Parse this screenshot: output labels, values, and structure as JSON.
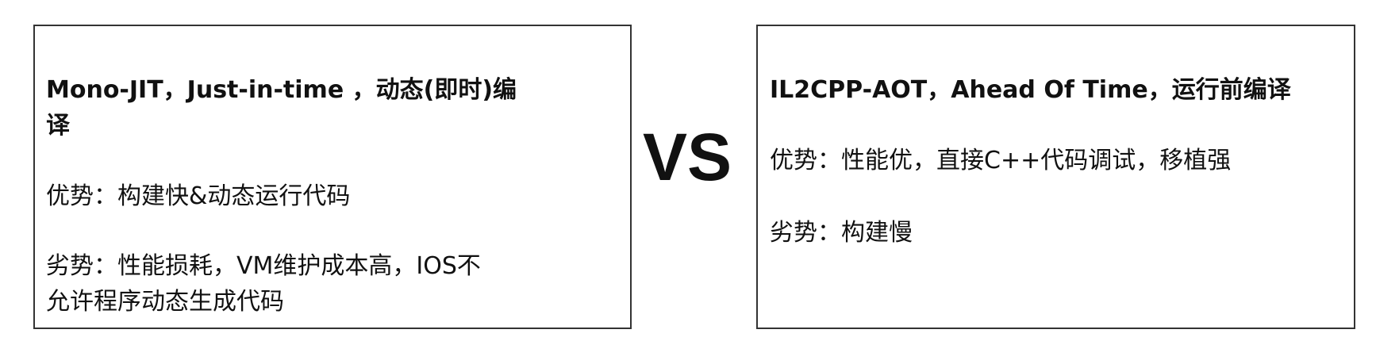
{
  "left": {
    "title_line1": "Mono-JIT，Just-in-time ，动态(即时)编",
    "title_line2": "译",
    "pros": "优势：构建快&动态运行代码",
    "cons_line1": "劣势：性能损耗，VM维护成本高，IOS不",
    "cons_line2": "允许程序动态生成代码"
  },
  "vs": "VS",
  "right": {
    "title": "IL2CPP-AOT，Ahead Of Time，运行前编译",
    "pros": "优势：性能优，直接C++代码调试，移植强",
    "cons": "劣势：构建慢"
  }
}
